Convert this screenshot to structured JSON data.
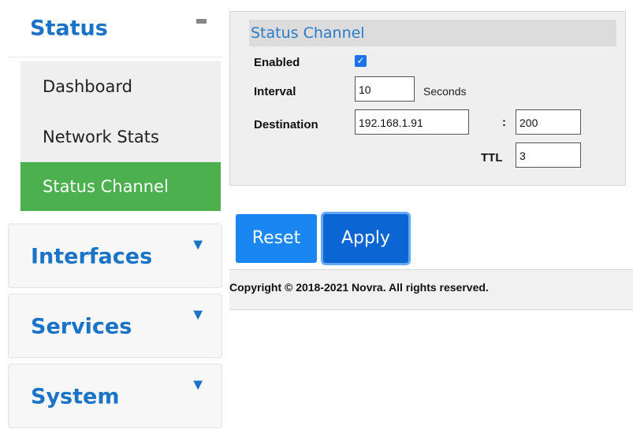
{
  "sidebar": {
    "status": {
      "title": "Status",
      "items": [
        "Dashboard",
        "Network Stats",
        "Status Channel"
      ],
      "active_item": "Status Channel"
    },
    "sections": [
      {
        "title": "Interfaces"
      },
      {
        "title": "Services"
      },
      {
        "title": "System"
      }
    ],
    "toggle_glyph": "▼"
  },
  "status_channel": {
    "title": "Status Channel",
    "enabled_label": "Enabled",
    "enabled": true,
    "interval_label": "Interval",
    "interval_value": "10",
    "interval_unit": "Seconds",
    "destination_label": "Destination",
    "destination_ip": "192.168.1.91",
    "separator": ":",
    "destination_port": "200",
    "ttl_label": "TTL",
    "ttl_value": "3"
  },
  "buttons": {
    "reset": "Reset",
    "apply": "Apply"
  },
  "footer": {
    "copyright": "Copyright © 2018-2021 Novra. All rights reserved."
  },
  "colors": {
    "accent": "#1a73c7",
    "active_green": "#4db04f",
    "button_blue": "#1a86f2"
  }
}
